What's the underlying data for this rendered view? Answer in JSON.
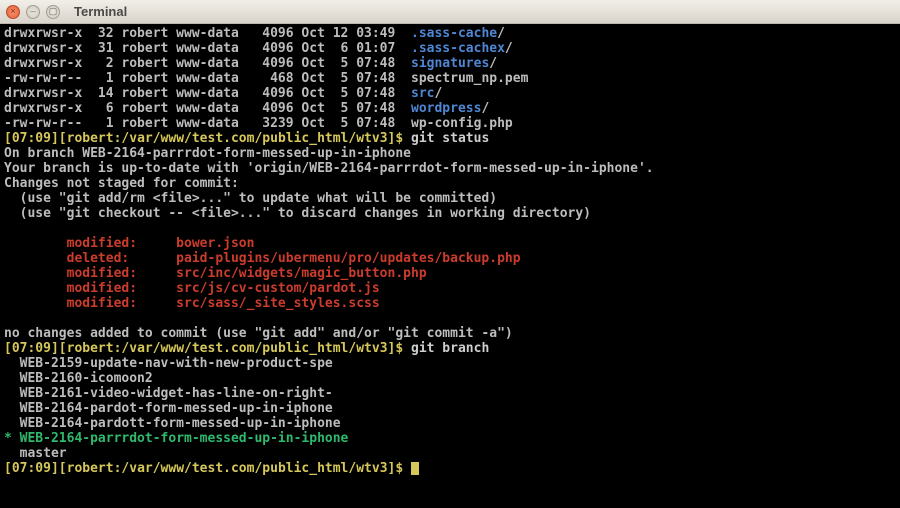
{
  "window": {
    "title": "Terminal"
  },
  "listing": [
    {
      "perm": "drwxrwsr-x",
      "links": "32",
      "user": "robert",
      "group": "www-data",
      "size": "4096",
      "date": "Oct 12 03:49",
      "name": ".sass-cache",
      "dir": true
    },
    {
      "perm": "drwxrwsr-x",
      "links": "31",
      "user": "robert",
      "group": "www-data",
      "size": "4096",
      "date": "Oct  6 01:07",
      "name": ".sass-cachex",
      "dir": true
    },
    {
      "perm": "drwxrwsr-x",
      "links": "2",
      "user": "robert",
      "group": "www-data",
      "size": "4096",
      "date": "Oct  5 07:48",
      "name": "signatures",
      "dir": true
    },
    {
      "perm": "-rw-rw-r--",
      "links": "1",
      "user": "robert",
      "group": "www-data",
      "size": "468",
      "date": "Oct  5 07:48",
      "name": "spectrum_np.pem",
      "dir": false
    },
    {
      "perm": "drwxrwsr-x",
      "links": "14",
      "user": "robert",
      "group": "www-data",
      "size": "4096",
      "date": "Oct  5 07:48",
      "name": "src",
      "dir": true
    },
    {
      "perm": "drwxrwsr-x",
      "links": "6",
      "user": "robert",
      "group": "www-data",
      "size": "4096",
      "date": "Oct  5 07:48",
      "name": "wordpress",
      "dir": true
    },
    {
      "perm": "-rw-rw-r--",
      "links": "1",
      "user": "robert",
      "group": "www-data",
      "size": "3239",
      "date": "Oct  5 07:48",
      "name": "wp-config.php",
      "dir": false
    }
  ],
  "prompt": {
    "time": "[07:09]",
    "path": "[robert:/var/www/test.com/public_html/wtv3]$"
  },
  "cmd1": "git status",
  "status": {
    "branch": "On branch WEB-2164-parrrdot-form-messed-up-in-iphone",
    "uptodate": "Your branch is up-to-date with 'origin/WEB-2164-parrrdot-form-messed-up-in-iphone'.",
    "notstaged": "Changes not staged for commit:",
    "hint1": "  (use \"git add/rm <file>...\" to update what will be committed)",
    "hint2": "  (use \"git checkout -- <file>...\" to discard changes in working directory)",
    "changes": [
      {
        "label": "modified:",
        "file": "bower.json"
      },
      {
        "label": "deleted:",
        "file": "paid-plugins/ubermenu/pro/updates/backup.php"
      },
      {
        "label": "modified:",
        "file": "src/inc/widgets/magic_button.php"
      },
      {
        "label": "modified:",
        "file": "src/js/cv-custom/pardot.js"
      },
      {
        "label": "modified:",
        "file": "src/sass/_site_styles.scss"
      }
    ],
    "nochanges": "no changes added to commit (use \"git add\" and/or \"git commit -a\")"
  },
  "cmd2": "git branch",
  "branches": [
    {
      "name": "WEB-2159-update-nav-with-new-product-spe",
      "current": false
    },
    {
      "name": "WEB-2160-icomoon2",
      "current": false
    },
    {
      "name": "WEB-2161-video-widget-has-line-on-right-",
      "current": false
    },
    {
      "name": "WEB-2164-pardot-form-messed-up-in-iphone",
      "current": false
    },
    {
      "name": "WEB-2164-pardott-form-messed-up-in-iphone",
      "current": false
    },
    {
      "name": "WEB-2164-parrrdot-form-messed-up-in-iphone",
      "current": true
    },
    {
      "name": "master",
      "current": false
    }
  ]
}
